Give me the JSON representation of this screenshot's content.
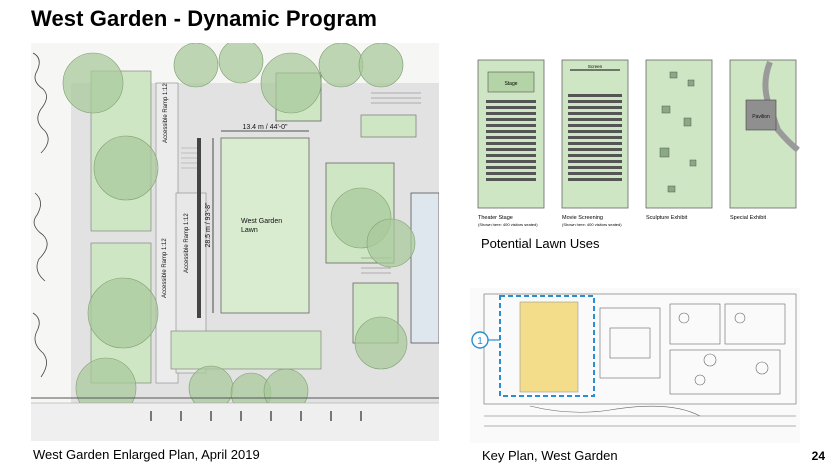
{
  "title": "West Garden - Dynamic Program",
  "plan": {
    "caption": "West Garden Enlarged Plan, April 2019",
    "dim_width": "13.4 m / 44'-0\"",
    "dim_length": "28.5 m / 93'-8\"",
    "lawn_label_line1": "West Garden",
    "lawn_label_line2": "Lawn",
    "ramp_label_1": "Accessible Ramp 1:12",
    "ramp_label_2": "Accessible Ramp 1:12",
    "ramp_label_3": "Accessible Ramp 1:12"
  },
  "uses": {
    "title": "Potential Lawn Uses",
    "items": [
      {
        "name": "Theater Stage",
        "note": "(Shown here: 400 visitors seated)",
        "inner": "Stage"
      },
      {
        "name": "Movie Screening",
        "note": "(Shown here: 400 visitors seated)",
        "inner": "Screen"
      },
      {
        "name": "Sculpture Exhibit",
        "note": "",
        "inner": ""
      },
      {
        "name": "Special Exhibit",
        "note": "",
        "inner": "Pavilion"
      }
    ]
  },
  "keyplan": {
    "caption": "Key Plan, West Garden",
    "marker": "1"
  },
  "page_number": "24",
  "colors": {
    "lawn": "#cfe6c4",
    "tree": "#a9c99c",
    "paving": "#dcdcdc",
    "highlight": "#f3dc8a",
    "callout": "#2a8fd0"
  }
}
